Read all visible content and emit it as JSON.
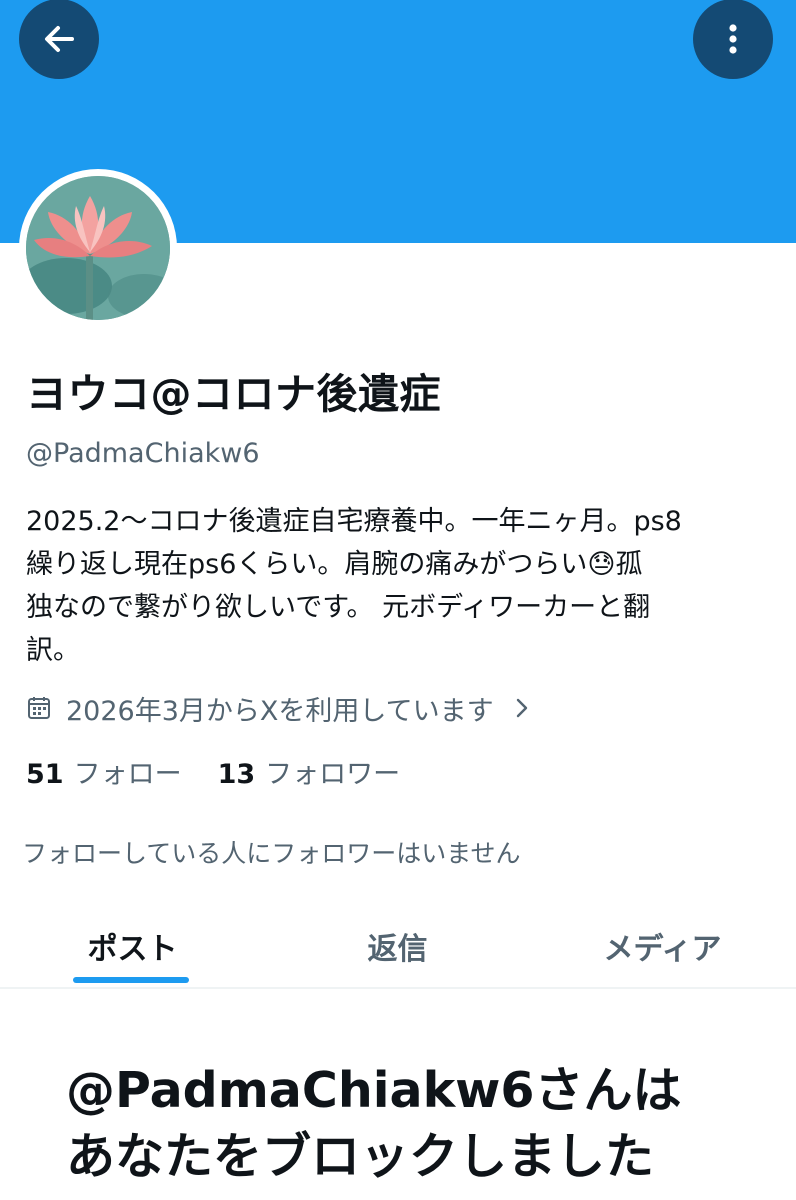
{
  "profile": {
    "display_name": "ヨウコ@コロナ後遺症",
    "handle": "@PadmaChiakw6",
    "bio_lines": [
      "2025.2〜コロナ後遺症自宅療養中。一年ニヶ月。ps8",
      "繰り返し現在ps6くらい。肩腕の痛みがつらい😓孤",
      "独なので繋がり欲しいです。 元ボディワーカーと翻",
      "訳。"
    ],
    "joined": "2026年3月からXを利用しています",
    "following_count": "51",
    "following_label": "フォロー",
    "followers_count": "13",
    "followers_label": "フォロワー",
    "no_common_followers": "フォローしている人にフォロワーはいません"
  },
  "tabs": [
    "ポスト",
    "返信",
    "メディア"
  ],
  "blocked_message": {
    "line1": "@PadmaChiakw6さんは",
    "line2": "あなたをブロックしました"
  },
  "icons": {
    "back": "arrow-left-icon",
    "more": "more-vertical-icon",
    "calendar": "calendar-icon",
    "chevron": "chevron-right-icon"
  },
  "colors": {
    "banner": "#1d9bf0",
    "accent": "#1d9bf0",
    "secondary_text": "#536471"
  }
}
